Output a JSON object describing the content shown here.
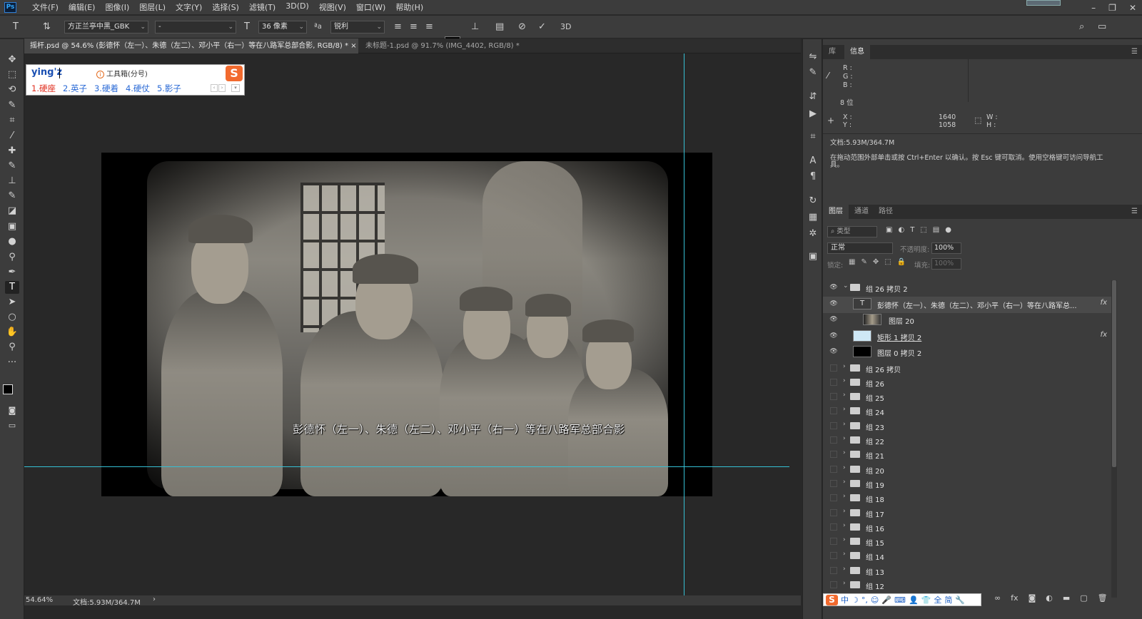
{
  "app": {
    "logo_text": "Ps",
    "menu": [
      "文件(F)",
      "编辑(E)",
      "图像(I)",
      "图层(L)",
      "文字(Y)",
      "选择(S)",
      "滤镜(T)",
      "3D(D)",
      "视图(V)",
      "窗口(W)",
      "帮助(H)"
    ],
    "window_controls": [
      "–",
      "❐",
      "✕"
    ]
  },
  "options": {
    "font_family": "方正兰亭中黑_GBK",
    "font_style": "-",
    "font_size": "36 像素",
    "antialias": "锐利",
    "three_d": "3D"
  },
  "tabs": [
    "摇杆.psd @ 54.6% (彭德怀（左一）、朱德（左二）、邓小平（右一）等在八路军总部合影, RGB/8) *",
    "未标题-1.psd @ 91.7% (IMG_4402, RGB/8) *"
  ],
  "tab_close": "×",
  "canvas": {
    "caption": "彭德怀（左一）、朱德（左二）、邓小平（右一）等在八路军总部合影"
  },
  "ime": {
    "input": "ying'z",
    "toolbox": "工具箱(分号)",
    "logo": "S",
    "candidates": [
      "1.硬座",
      "2.英子",
      "3.硬着",
      "4.硬仗",
      "5.影子"
    ]
  },
  "status": {
    "zoom": "54.64%",
    "doc": "文档:5.93M/364.7M",
    "arrow": "›"
  },
  "info_panel": {
    "tabs": [
      "库",
      "信息"
    ],
    "r": "R :",
    "g": "G :",
    "b": "B :",
    "bit": "8 位",
    "x": "X :",
    "y": "Y :",
    "x_val": "1640",
    "y_val": "1058",
    "w": "W :",
    "h": "H :",
    "doc": "文档:5.93M/364.7M",
    "hint": "在拖动范围外部单击或按 Ctrl+Enter 以确认。按 Esc 键可取消。使用空格键可访问导航工具。"
  },
  "layers_panel": {
    "tabs": [
      "图层",
      "通道",
      "路径"
    ],
    "filter": "类型",
    "blend_mode": "正常",
    "opacity_label": "不透明度:",
    "opacity": "100%",
    "lock_label": "锁定:",
    "fill_label": "填充:",
    "fill": "100%",
    "fx": "fx",
    "layers": [
      {
        "name": "组 26 拷贝 2",
        "kind": "group-open",
        "visible": true
      },
      {
        "name": "彭德怀（左一）、朱德（左二）、邓小平（右一）等在八路军总...",
        "kind": "text",
        "visible": true,
        "fx": true
      },
      {
        "name": "图层 20",
        "kind": "image",
        "visible": true
      },
      {
        "name": "矩形 1 拷贝 2",
        "kind": "shape",
        "visible": true,
        "fx": true
      },
      {
        "name": "图层 0 拷贝 2",
        "kind": "black",
        "visible": true
      },
      {
        "name": "组 26 拷贝",
        "kind": "group",
        "visible": false
      },
      {
        "name": "组 26",
        "kind": "group",
        "visible": false
      },
      {
        "name": "组 25",
        "kind": "group",
        "visible": false
      },
      {
        "name": "组 24",
        "kind": "group",
        "visible": false
      },
      {
        "name": "组 23",
        "kind": "group",
        "visible": false
      },
      {
        "name": "组 22",
        "kind": "group",
        "visible": false
      },
      {
        "name": "组 21",
        "kind": "group",
        "visible": false
      },
      {
        "name": "组 20",
        "kind": "group",
        "visible": false
      },
      {
        "name": "组 19",
        "kind": "group",
        "visible": false
      },
      {
        "name": "组 18",
        "kind": "group",
        "visible": false
      },
      {
        "name": "组 17",
        "kind": "group",
        "visible": false
      },
      {
        "name": "组 16",
        "kind": "group",
        "visible": false
      },
      {
        "name": "组 15",
        "kind": "group",
        "visible": false
      },
      {
        "name": "组 14",
        "kind": "group",
        "visible": false
      },
      {
        "name": "组 13",
        "kind": "group",
        "visible": false
      },
      {
        "name": "组 12",
        "kind": "group",
        "visible": false
      }
    ]
  },
  "ime_bar": [
    "中",
    "☽",
    "°,",
    "☺",
    "🎤",
    "⌨",
    "👤",
    "👕",
    "全",
    "简",
    "🔧"
  ],
  "colors": {
    "guide": "#35c0d4",
    "accent": "#31a8ff",
    "ime_red": "#e02c1c",
    "ime_blue": "#2a6ad6"
  }
}
